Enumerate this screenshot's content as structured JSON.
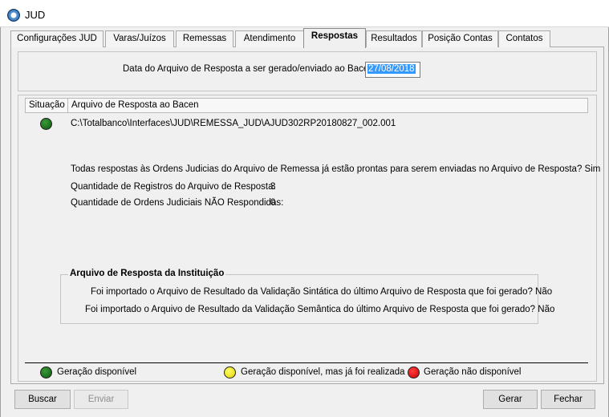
{
  "window": {
    "title": "JUD"
  },
  "tabs": [
    {
      "label": "Configurações JUD"
    },
    {
      "label": "Varas/Juízos"
    },
    {
      "label": "Remessas"
    },
    {
      "label": "Atendimento"
    },
    {
      "label": "Respostas"
    },
    {
      "label": "Resultados"
    },
    {
      "label": "Posição Contas"
    },
    {
      "label": "Contatos"
    }
  ],
  "active_tab": "Respostas",
  "date_section": {
    "label": "Data do Arquivo de Resposta a ser gerado/enviado ao Bacen:",
    "value": "27/08/2018"
  },
  "grid": {
    "columns": [
      "Situação",
      "Arquivo de Resposta ao Bacen"
    ],
    "rows": [
      {
        "status": "green",
        "path": "C:\\Totalbanco\\Interfaces\\JUD\\REMESSA_JUD\\AJUD302RP20180827_002.001"
      }
    ]
  },
  "info": {
    "all_ready_text": "Todas respostas às Ordens Judicias do Arquivo de Remessa já estão prontas para serem enviadas no Arquivo de Resposta?  Sim",
    "records_label": "Quantidade de Registros do Arquivo de Resposta:",
    "records_value": "3",
    "unanswered_label": "Quantidade de Ordens Judiciais NÃO Respondidas:",
    "unanswered_value": "0"
  },
  "institution": {
    "title": "Arquivo de Resposta da Instituição",
    "syntactic": "Foi importado o Arquivo de Resultado da Validação Sintática do último Arquivo de Resposta que foi gerado?  Não",
    "semantic": "Foi importado o Arquivo de Resultado da Validação Semântica do último Arquivo de Resposta que foi gerado?  Não"
  },
  "legend": {
    "available": "Geração disponível",
    "available_done": "Geração disponível, mas já foi realizada",
    "unavailable": "Geração não disponível",
    "colors": {
      "green": "#0d5a0d",
      "yellow": "#f0e000",
      "red": "#e00000"
    }
  },
  "buttons": {
    "buscar": "Buscar",
    "enviar": "Enviar",
    "gerar": "Gerar",
    "fechar": "Fechar"
  }
}
